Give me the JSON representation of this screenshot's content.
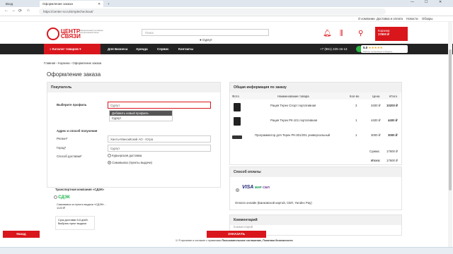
{
  "browser": {
    "tabs": [
      "Вход",
      "Оформление заказа"
    ],
    "url": "https://center-sv.ru/simplecheckout/",
    "close_glyph": "✕",
    "new_tab_glyph": "+",
    "window_controls": [
      "—",
      "☐",
      "✕"
    ],
    "nav_glyphs": [
      "←",
      "→",
      "⟳",
      "⌂"
    ]
  },
  "top_links": [
    "О компании",
    "Доставка и оплата",
    "Новости",
    "Обзоры"
  ],
  "header": {
    "logo_line1": "ЦЕНТР",
    "logo_line2": "СВЯЗИ",
    "logo_sub": "Официальный поставщик корпоративной связи",
    "search_placeholder": "Поиск",
    "city": "Сургут",
    "cart_label": "Корзина",
    "cart_sum": "17600 ₽",
    "cart_count": "1",
    "icons": [
      "bell-icon",
      "compare-icon",
      "user-icon",
      "cart-icon"
    ]
  },
  "nav": {
    "catalog": "Каталог товаров",
    "items": [
      "Для Бизнеса",
      "Аренда",
      "Сервис",
      "Контакты"
    ],
    "phone": "+7 (861) 225-16-14",
    "rating": "5.0",
    "rating_stars": "★★★★★",
    "rating_caption": "Рейтинг организации в Яндексе"
  },
  "breadcrumb": [
    "Главная",
    "Корзина",
    "Оформление заказа"
  ],
  "page_title": "Оформление заказа",
  "buyer": {
    "heading": "Покупатель",
    "profile_label": "Выберите профиль",
    "profile_value": "Сургут",
    "dropdown_options": [
      "Добавить новый профиль",
      "Сургут"
    ],
    "hint": "Если Вам нужно оформить заказ на... выберите другой профиль или до... в доступе в личном кабинете, в разделе «Список профилей заказа»",
    "address_heading": "Адрес и способ получения",
    "region_label": "Регион*",
    "region_value": "Ханты-Мансийский АО - Югра",
    "city_label": "Город*",
    "city_value": "Сургут",
    "delivery_label": "Способ доставки*",
    "delivery_options": [
      "Курьерская доставка",
      "Самовывоз (пункты выдачи)"
    ]
  },
  "transport": {
    "heading": "Транспортная компания «СДЭК»",
    "logo": "СДЭК",
    "option": "Самовывоз из пункта выдачи «СДЭК» - 1123 ₽",
    "term": "Срок доставки 5-6 дней. Выбрать пункт выдачи"
  },
  "order": {
    "heading": "Общая информация по заказу",
    "columns": [
      "Фото",
      "Наименование товара",
      "Кол-во",
      "Цена",
      "Итого"
    ],
    "rows": [
      {
        "name": "Рация Терек Спорт портативная",
        "qty": "3",
        "price": "3400 ₽",
        "total": "10200 ₽"
      },
      {
        "name": "Рация Терек РК-101 портативная",
        "qty": "1",
        "price": "4400 ₽",
        "total": "4400 ₽"
      },
      {
        "name": "Программатор для Терек РК-301/201 универсальный",
        "qty": "1",
        "price": "3000 ₽",
        "total": "3000 ₽"
      }
    ],
    "sum_label": "Сумма:",
    "sum_value": "17600 ₽",
    "total_label": "Итого:",
    "total_value": "17600 ₽"
  },
  "payment": {
    "heading": "Способ оплаты",
    "brands": [
      "VISA",
      "МИР",
      "СБП"
    ],
    "description": "Оплата онлайн (Банковской картой, СБП, Yandex Pay)"
  },
  "comment": {
    "heading": "Комментарий",
    "placeholder": "Комментарий"
  },
  "footer": {
    "back": "Назад",
    "submit": "ЗАКАЗАТЬ",
    "agree_prefix": "Я прочитал и согласен с правилами",
    "agree_links": "Пользовательское соглашение, Политика безопасности"
  },
  "colors": {
    "accent": "#d9161c",
    "nav_bg": "#222222"
  }
}
